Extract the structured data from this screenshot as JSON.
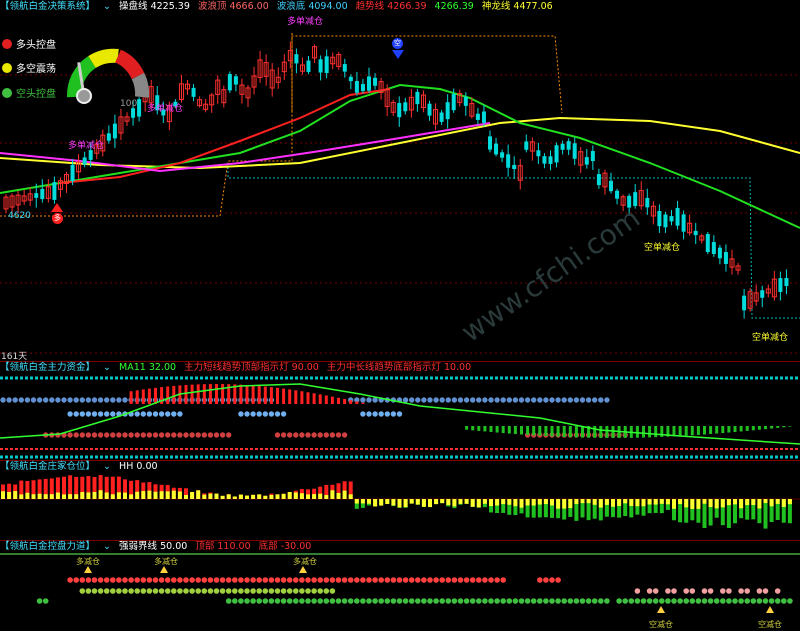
{
  "colors": {
    "bg": "#000000",
    "up": "#ff3030",
    "down": "#00dcdc",
    "ma_red": "#ff2020",
    "ma_green": "#20e020",
    "ma_yellow": "#ffff30",
    "ma_magenta": "#ff30ff",
    "dotted": "#ff8c00",
    "cyan_dotted": "#00b4b4",
    "grid": "#7a0000"
  },
  "main": {
    "title": "【领航白金决策系统】",
    "values": [
      {
        "label": "操盘线",
        "value": "4225.39",
        "color": "#ffffff"
      },
      {
        "label": "波浪顶",
        "value": "4666.00",
        "color": "#ff6464"
      },
      {
        "label": "波浪底",
        "value": "4094.00",
        "color": "#40d0ff"
      },
      {
        "label": "趋势线",
        "value": "4266.39",
        "color": "#ff3030"
      },
      {
        "label": "",
        "value": "4266.39",
        "color": "#30ff30"
      },
      {
        "label": "神龙线",
        "value": "4477.06",
        "color": "#ffff30"
      }
    ],
    "legend": [
      {
        "label": "多头控盘",
        "color": "#e02020",
        "text_color": "#ffffff"
      },
      {
        "label": "多空震荡",
        "color": "#e8e800",
        "text_color": "#ffffff"
      },
      {
        "label": "空头控盘",
        "color": "#40c040",
        "text_color": "#40c040"
      }
    ],
    "gauge": {
      "max": "100",
      "level": 0.45
    },
    "annotations": {
      "buy_reduce_1": "多单减仓",
      "buy_reduce_2": "多单减仓",
      "buy_reduce_3": "多单减仓",
      "sell_reduce_1": "空单减仓",
      "sell_reduce_2": "空单减仓",
      "price_low": "4620",
      "duo_marker": "多",
      "kong_marker": "空"
    },
    "days_label": "161天"
  },
  "panel1": {
    "title": "【领航白金主力资金】",
    "items": [
      {
        "label": "MA11",
        "value": "32.00",
        "color": "#30ff30"
      },
      {
        "label": "主力短线趋势顶部指示灯",
        "value": "90.00",
        "color": "#ff3030"
      },
      {
        "label": "主力中长线趋势底部指示灯",
        "value": "10.00",
        "color": "#ff3030"
      }
    ]
  },
  "panel2": {
    "title": "【领航白金庄家仓位】",
    "items": [
      {
        "label": "HH",
        "value": "0.00",
        "color": "#ffffff"
      }
    ]
  },
  "panel3": {
    "title": "【领航白金控盘力道】",
    "items": [
      {
        "label": "强弱界线",
        "value": "50.00",
        "color": "#ffffff"
      },
      {
        "label": "顶部",
        "value": "110.00",
        "color": "#ff3030"
      },
      {
        "label": "底部",
        "value": "-30.00",
        "color": "#ff3030"
      }
    ],
    "annotations": {
      "top_1": "多减仓",
      "top_2": "多减仓",
      "top_3": "多减仓",
      "bottom_1": "空减仓",
      "bottom_2": "空减仓"
    }
  },
  "watermark": "www.cfchi.com"
}
